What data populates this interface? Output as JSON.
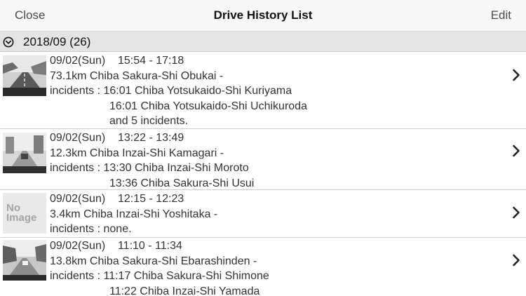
{
  "nav": {
    "left_label": "Close",
    "title": "Drive History List",
    "right_label": "Edit"
  },
  "section": {
    "label": "2018/09 (26)",
    "icon": "circle-chevron-down-icon"
  },
  "rows": [
    {
      "date": "09/02(Sun)",
      "time": "15:54 - 17:18",
      "route": "73.1km Chiba Sakura-Shi Obukai -",
      "incidents_prefix": "incidents :",
      "incidents": [
        "16:01 Chiba Yotsukaido-Shi Kuriyama",
        "16:01 Chiba Yotsukaido-Shi Uchikuroda",
        "and 5 incidents."
      ],
      "thumbnail": "road-photo"
    },
    {
      "date": "09/02(Sun)",
      "time": "13:22 - 13:49",
      "route": "12.3km Chiba Inzai-Shi Kamagari -",
      "incidents_prefix": "incidents :",
      "incidents": [
        "13:30 Chiba Inzai-Shi Moroto",
        "13:36 Chiba Sakura-Shi Usui"
      ],
      "thumbnail": "road-photo"
    },
    {
      "date": "09/02(Sun)",
      "time": "12:15 - 12:23",
      "route": "3.4km Chiba Inzai-Shi Yoshitaka -",
      "incidents_prefix": "incidents :",
      "incidents": [
        "none."
      ],
      "thumbnail": "no-image",
      "no_image_line1": "No",
      "no_image_line2": "Image"
    },
    {
      "date": "09/02(Sun)",
      "time": "11:10 - 11:34",
      "route": "13.8km Chiba Sakura-Shi Ebarashinden -",
      "incidents_prefix": "incidents :",
      "incidents": [
        "11:17 Chiba Sakura-Shi Shimone",
        "11:22 Chiba Inzai-Shi Yamada"
      ],
      "thumbnail": "road-photo"
    }
  ]
}
